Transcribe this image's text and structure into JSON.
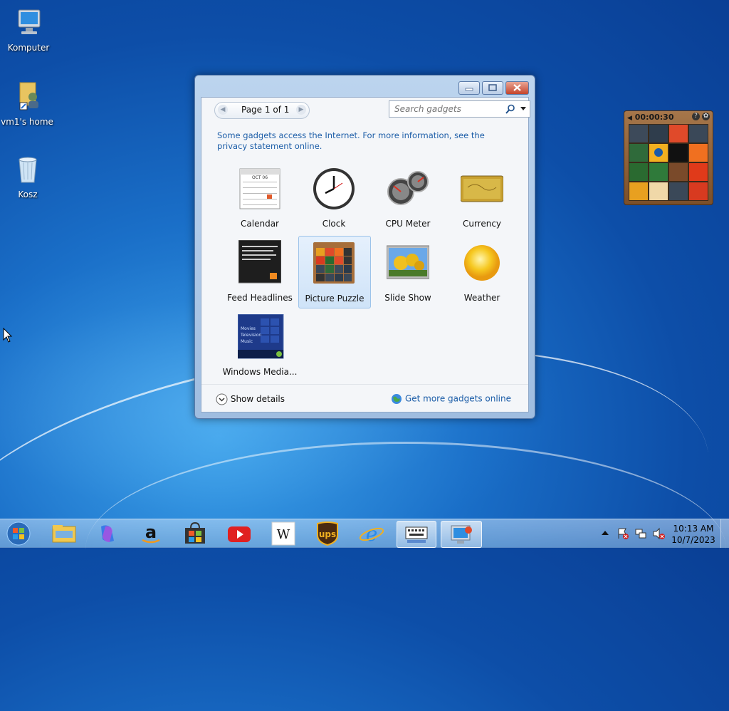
{
  "desktop": {
    "icons": [
      {
        "label": "Komputer"
      },
      {
        "label": "vm1's home"
      },
      {
        "label": "Kosz"
      }
    ]
  },
  "puzzle_gadget": {
    "timer": "00:00:30"
  },
  "gadget_window": {
    "pager": {
      "label": "Page 1 of 1"
    },
    "search": {
      "placeholder": "Search gadgets"
    },
    "info_text": "Some gadgets access the Internet.  For more information, see the privacy statement online.",
    "gadgets": [
      {
        "label": "Calendar",
        "icon": "calendar-icon"
      },
      {
        "label": "Clock",
        "icon": "clock-icon"
      },
      {
        "label": "CPU Meter",
        "icon": "cpu-meter-icon"
      },
      {
        "label": "Currency",
        "icon": "currency-icon"
      },
      {
        "label": "Feed Headlines",
        "icon": "feed-headlines-icon"
      },
      {
        "label": "Picture Puzzle",
        "icon": "picture-puzzle-icon",
        "selected": true
      },
      {
        "label": "Slide Show",
        "icon": "slide-show-icon"
      },
      {
        "label": "Weather",
        "icon": "weather-icon"
      },
      {
        "label": "Windows Media...",
        "icon": "windows-media-icon"
      }
    ],
    "calendar_month": "OCT 06",
    "media_center_items": [
      "Movies",
      "Television",
      "Music"
    ],
    "show_details": "Show details",
    "get_more": "Get more gadgets online"
  },
  "taskbar": {
    "items": [
      "start-button",
      "file-explorer",
      "copilot",
      "amazon",
      "microsoft-store",
      "youtube",
      "wikipedia",
      "ups",
      "internet-explorer",
      "on-screen-keyboard",
      "gadgets"
    ],
    "wikipedia_letter": "W",
    "ups_letters": "ups",
    "clock": {
      "time": "10:13 AM",
      "date": "10/7/2023"
    }
  }
}
